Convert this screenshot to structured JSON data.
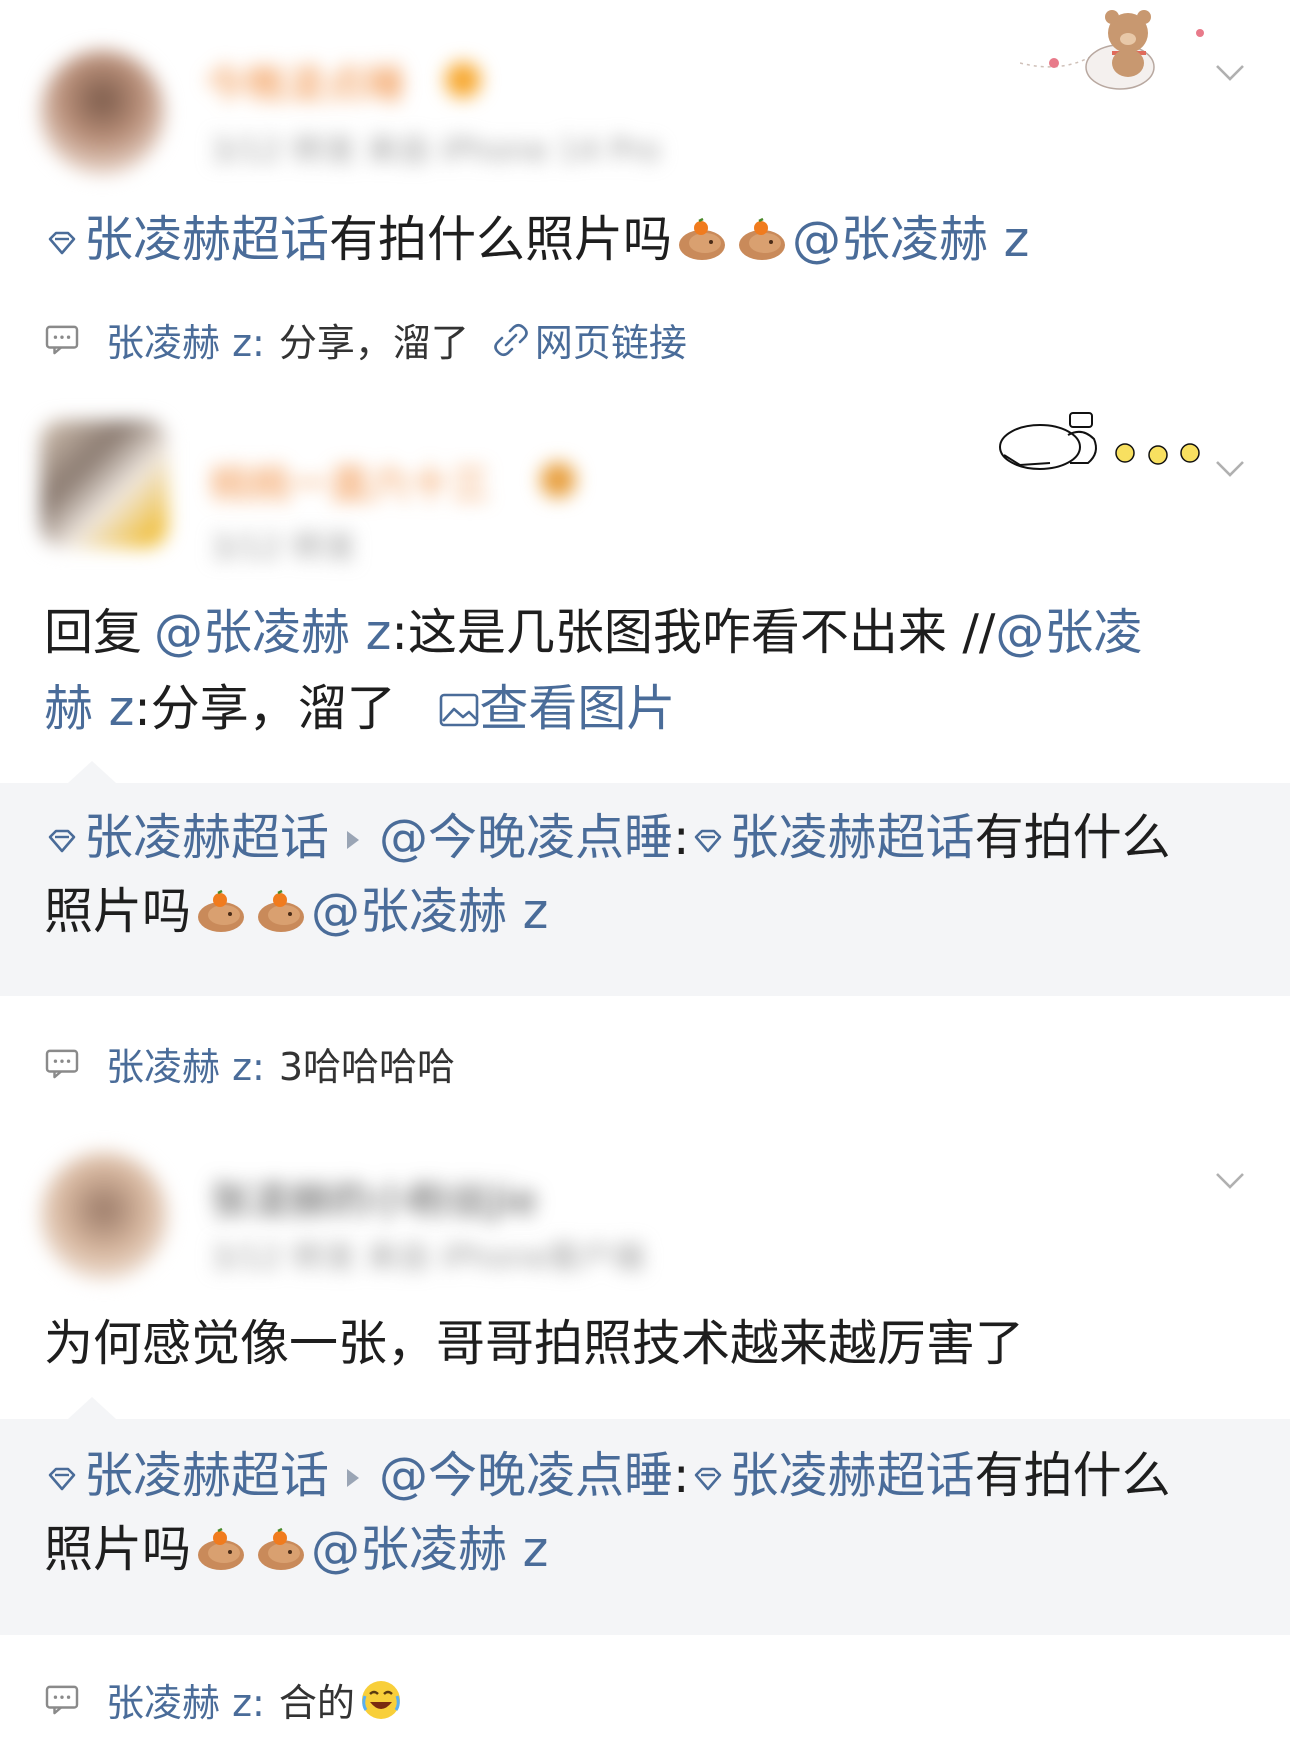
{
  "colors": {
    "link": "#4a6c99",
    "background": "#ffffff",
    "quote_bg": "#f4f5f7",
    "text": "#1e1e1e"
  },
  "post1": {
    "name": "今晚凌点睡",
    "meta": "3/12 转发  来自 iPhone 14 Pro",
    "topic": "张凌赫超话",
    "text": "有拍什么照片吗",
    "mention": "@张凌赫 z",
    "comment_author": "张凌赫 z:",
    "comment_text": "分享，溜了",
    "comment_link": "网页链接"
  },
  "post2": {
    "name": "桃桃一直六十三",
    "meta": "3/12 转发",
    "reply_prefix": "回复",
    "reply_mention": "@张凌赫 z",
    "reply_text": ":这是几张图我咋看不出来 //",
    "reply_mention2": "@张凌",
    "line2_mention": "赫 z",
    "line2_text": ":分享，溜了",
    "view_image": "查看图片",
    "quote_topic": "张凌赫超话",
    "quote_author": "@今晚凌点睡",
    "quote_colon": ":",
    "quote_topic2": "张凌赫超话",
    "quote_text": "有拍什么",
    "quote_line2_text": "照片吗",
    "quote_mention": "@张凌赫 z",
    "comment_author": "张凌赫 z:",
    "comment_text": "3哈哈哈哈"
  },
  "post3": {
    "name": "张凌赫的小粉丝Jie",
    "meta": "3/12 转发  来自 iPhone客户端",
    "text": "为何感觉像一张，哥哥拍照技术越来越厉害了",
    "quote_topic": "张凌赫超话",
    "quote_author": "@今晚凌点睡",
    "quote_colon": ":",
    "quote_topic2": "张凌赫超话",
    "quote_text": "有拍什么",
    "quote_line2_text": "照片吗",
    "quote_mention": "@张凌赫 z",
    "comment_author": "张凌赫 z:",
    "comment_text": "合的"
  },
  "icons": [
    "chevron-down-icon",
    "comment-icon",
    "link-icon",
    "image-icon",
    "diamond-icon",
    "capybara-emoji",
    "laughing-emoji",
    "bear-sticker",
    "bunny-sticker"
  ]
}
